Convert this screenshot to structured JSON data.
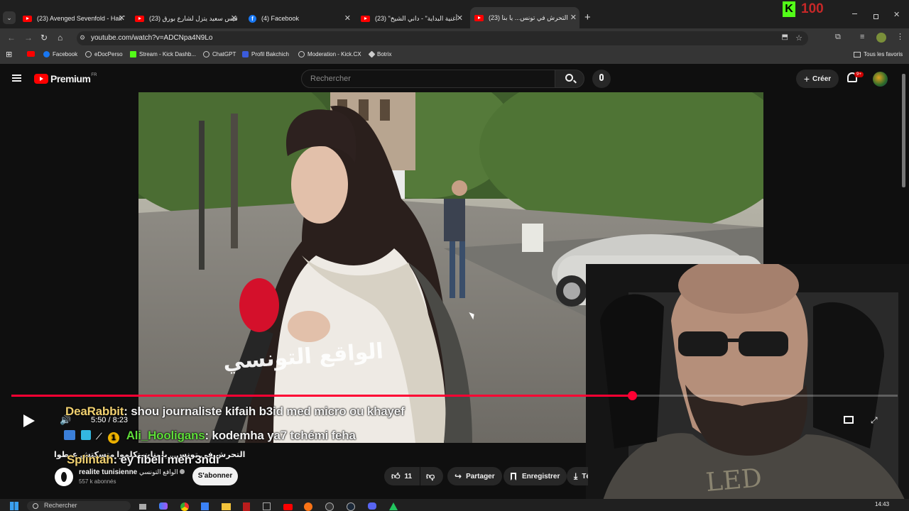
{
  "tabs": [
    {
      "label": "(23) Avenged Sevenfold - Hail T",
      "icon": "youtube-icon"
    },
    {
      "label": "(23) قيس سعيد يتزل لشارع بورق",
      "icon": "youtube-icon"
    },
    {
      "label": "(4) Facebook",
      "icon": "facebook-icon"
    },
    {
      "label": "(23) \"أغنية البداية\" - داني الشيخ",
      "icon": "youtube-icon"
    },
    {
      "label": "(23) التحرش في تونس... يا بنا",
      "icon": "youtube-icon",
      "active": true
    }
  ],
  "overlay": {
    "kick_score": "100",
    "kick_letter": "K"
  },
  "address_bar": {
    "url": "youtube.com/watch?v=ADCNpa4N9Lo"
  },
  "bookmarks": [
    "Facebook",
    "eDocPerso",
    "Stream - Kick Dashb...",
    "ChatGPT",
    "Profil Bakchich",
    "Moderation - Kick.CX",
    "Botrix"
  ],
  "bookmarks_all": "Tous les favoris",
  "youtube": {
    "logo_text": "Premium",
    "region": "FR",
    "search_placeholder": "Rechercher",
    "create_label": "Créer",
    "notif_badge": "9+"
  },
  "video": {
    "watermark": "الواقع التونسي",
    "time": "5:50 / 8:23",
    "progress": 0.7,
    "title_arabic": "التحرش في تونس... يا بنات تكلموا متسكتش عيطوا"
  },
  "chat": [
    {
      "user": "DeaRabbit",
      "message": ": shou journaliste kifaih b3id med micro ou khayef",
      "color": "#f0d070"
    },
    {
      "user": "Ali_Hooligans",
      "message": ": kodemha ya7 tchémi feha",
      "color": "#5fdc3a"
    },
    {
      "user": "Splintah",
      "message": ": ey fibeli men 3ndi",
      "color": "#f0d070"
    }
  ],
  "channel": {
    "name": "realite tunisienne",
    "name_arabic": "الواقع التونسي",
    "subscribers": "557 k abonnés",
    "subscribe_label": "S'abonner"
  },
  "actions": {
    "likes": "11",
    "share": "Partager",
    "save": "Enregistrer",
    "download": "Télé"
  },
  "taskbar": {
    "search": "Rechercher",
    "time": "14:43"
  }
}
